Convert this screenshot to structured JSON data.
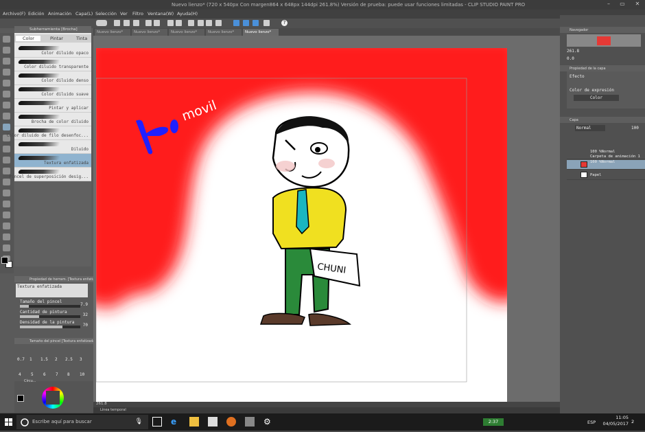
{
  "window": {
    "title": "Nuevo lienzo* (720 x 540px Con margen864 x 648px 144dpi 261.8%)  Versión de prueba: puede usar funciones limitadas - CLIP STUDIO PAINT PRO"
  },
  "menu": [
    "Archivo(F)",
    "Edición",
    "Animación",
    "Capa(L)",
    "Selección",
    "Ver",
    "Filtro",
    "Ventana(W)",
    "Ayuda(H)"
  ],
  "doc_tabs": [
    "Nuevo lienzo*",
    "Nuevo lienzo*",
    "Nuevo lienzo*",
    "Nuevo lienzo*",
    "Nuevo lienzo*"
  ],
  "subtool": {
    "header": "Subherramienta [Brocha]",
    "tabs": [
      "Color",
      "Pintar",
      "Tinta"
    ],
    "brushes": [
      "Color diluido opaco",
      "Color diluido transparente",
      "Color diluido denso",
      "Color diluido suave",
      "Pintar y aplicar",
      "Brocha de color diluido",
      "Color diluido de filo desenfoc...",
      "Diluido",
      "Textura enfatizada",
      "Pincel de superposición desig..."
    ]
  },
  "tool_property": {
    "header": "Propiedad de herram. [Textura enfatiza...",
    "name": "Textura enfatizada",
    "rows": [
      {
        "label": "Tamaño del pincel",
        "value": "7.9",
        "level": 0.15
      },
      {
        "label": "Cantidad de pintura",
        "value": "32",
        "level": 0.32
      },
      {
        "label": "Densidad de la pintura",
        "value": "70",
        "level": 0.7
      }
    ]
  },
  "brush_size": {
    "header": "Tamaño del pincel [Textura enfatizada",
    "row1": [
      "0.7",
      "1",
      "1.5",
      "2",
      "2.5",
      "3"
    ],
    "row2": [
      "4",
      "5",
      "6",
      "7",
      "8",
      "10"
    ]
  },
  "color_panel_label": "Círcu...",
  "canvas_art": {
    "text_movil": "movil",
    "sign_text": "CHUNI"
  },
  "status": {
    "zoom": "261.8",
    "timeline_label": "Línea temporal"
  },
  "navigator": {
    "header": "Navegador",
    "zoom": "261.8",
    "angle": "0.0"
  },
  "layer_property": {
    "header": "Propiedad de la capa",
    "effect_label": "Efecto",
    "expression_label": "Color de expresión",
    "expression_value": "Color"
  },
  "layers": {
    "header": "Capa",
    "blend_mode": "Normal",
    "opacity": "100",
    "items": [
      {
        "line1": "100 %Normal",
        "line2": "Carpeta de animación 1"
      },
      {
        "line1": "100 %Normal",
        "line2": ""
      },
      {
        "line1": "Papel",
        "line2": ""
      }
    ]
  },
  "taskbar": {
    "search_placeholder": "Escribe aquí para buscar",
    "tray_time": "2:37",
    "language": "ESP",
    "time": "11:05",
    "date": "04/05/2017",
    "notif_count": "2"
  },
  "colors": {
    "red_paint": "#ff1a1a",
    "shirt": "#f0e020",
    "tie": "#1ab6c0",
    "pants": "#2a8a3a",
    "selection_blue": "#8fb3cf"
  }
}
